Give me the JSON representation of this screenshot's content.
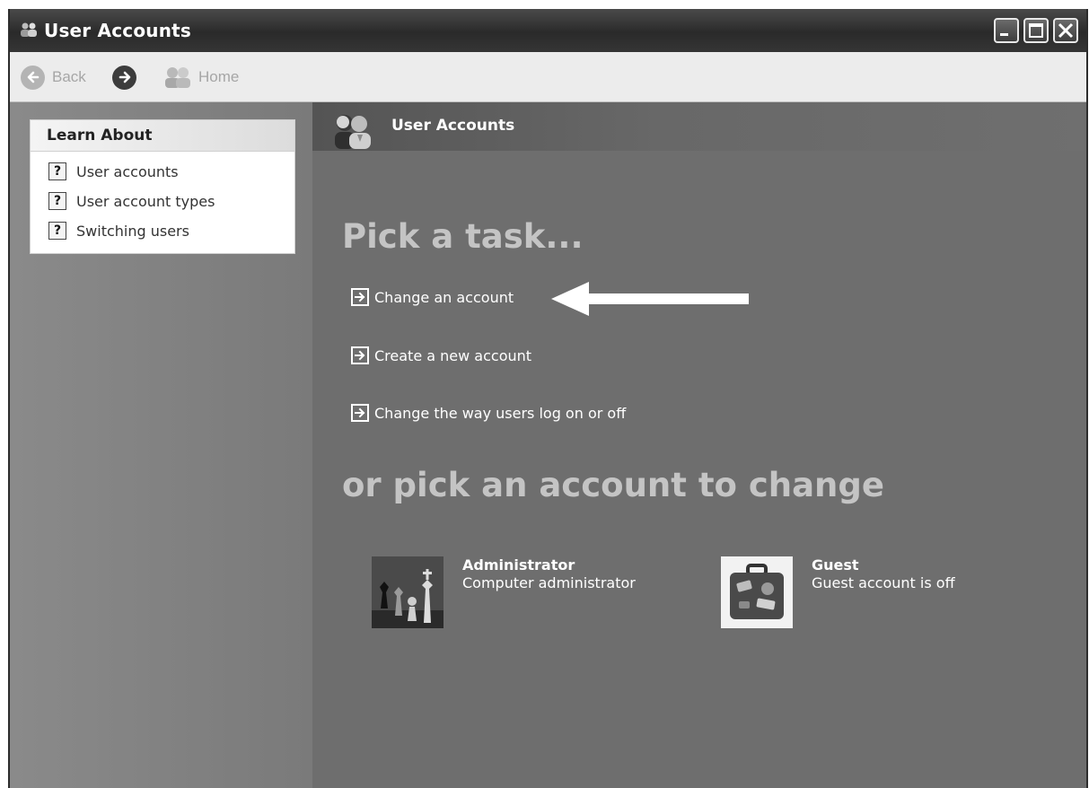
{
  "window": {
    "title": "User Accounts"
  },
  "toolbar": {
    "back_label": "Back",
    "home_label": "Home"
  },
  "sidebar": {
    "section_title": "Learn About",
    "items": [
      {
        "label": "User accounts"
      },
      {
        "label": "User account types"
      },
      {
        "label": "Switching users"
      }
    ]
  },
  "main": {
    "header_title": "User Accounts",
    "pick_task_heading": "Pick a task...",
    "tasks": [
      {
        "label": "Change an account"
      },
      {
        "label": "Create a new account"
      },
      {
        "label": "Change the way users log on or off"
      }
    ],
    "pick_account_heading": "or pick an account to change",
    "accounts": [
      {
        "name": "Administrator",
        "type": "Computer administrator",
        "picture": "chess-pieces"
      },
      {
        "name": "Guest",
        "type": "Guest account is off",
        "picture": "suitcase"
      }
    ]
  }
}
